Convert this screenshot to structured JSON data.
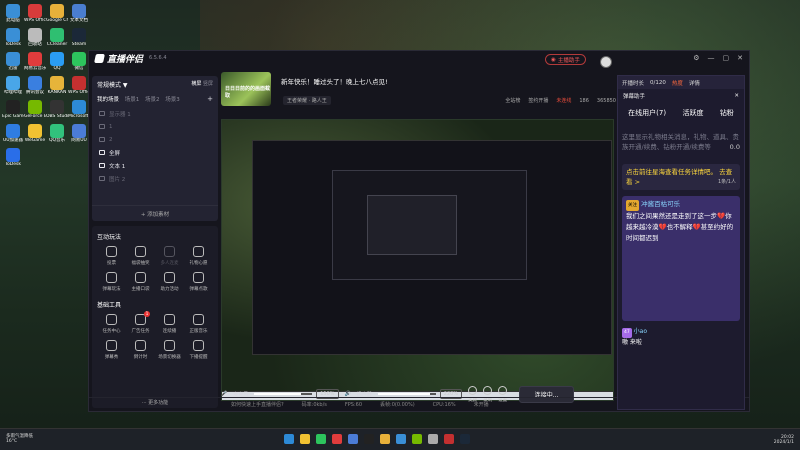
{
  "desktop": {
    "icons": [
      {
        "label": "此电脑",
        "color": "#3a8fd6"
      },
      {
        "label": "WPS Office",
        "color": "#d83b3b"
      },
      {
        "label": "Google Chrome",
        "color": "#e8b13a"
      },
      {
        "label": "文本文档",
        "color": "#4a7ed0"
      },
      {
        "label": "ToDesk",
        "color": "#3a8fd6"
      },
      {
        "label": "回收站",
        "color": "#bbb"
      },
      {
        "label": "CCleaner",
        "color": "#2fbf71"
      },
      {
        "label": "Steam",
        "color": "#1b2838"
      },
      {
        "label": "迅雷",
        "color": "#3a8fd6"
      },
      {
        "label": "网易云音乐",
        "color": "#e03c3c"
      },
      {
        "label": "QQ",
        "color": "#2a9df4"
      },
      {
        "label": "微信",
        "color": "#2dc45d"
      },
      {
        "label": "哔哩哔哩",
        "color": "#49a6e8"
      },
      {
        "label": "腾讯会议",
        "color": "#3a7fe0"
      },
      {
        "label": "KANKAN",
        "color": "#e6b43a"
      },
      {
        "label": "WPS Office",
        "color": "#c43030"
      },
      {
        "label": "Epic Games Launcher",
        "color": "#222"
      },
      {
        "label": "GeForce Experience",
        "color": "#76b900"
      },
      {
        "label": "OBS Studio",
        "color": "#333"
      },
      {
        "label": "Microsoft Edge",
        "color": "#2d8ad6"
      },
      {
        "label": "UU加速器",
        "color": "#2f7de1"
      },
      {
        "label": "WeGame",
        "color": "#f1c232"
      },
      {
        "label": "QQ音乐",
        "color": "#31c27c"
      },
      {
        "label": "网易UU",
        "color": "#4b7cd6"
      },
      {
        "label": "ToDesk",
        "color": "#2a6ee8"
      }
    ]
  },
  "app": {
    "name": "直播伴侣",
    "version": "6.5.6.4",
    "go_live": "主播助手",
    "window_controls": [
      "⚙",
      "—",
      "▢",
      "✕"
    ]
  },
  "scene": {
    "mode": "常规模式 ▼",
    "mode_right": [
      "横屏",
      "竖屏"
    ],
    "my_scenes": "我的场景",
    "scene_tabs": [
      "场景1",
      "场景2",
      "场景3"
    ],
    "sources": [
      {
        "label": "显示器 1",
        "on": false
      },
      {
        "label": "1",
        "on": false
      },
      {
        "label": "2",
        "on": false
      },
      {
        "label": "全屏",
        "on": true
      },
      {
        "label": "文本 1",
        "on": true
      },
      {
        "label": "图片 2",
        "on": false
      }
    ],
    "add_source": "+ 添加素材"
  },
  "tools": {
    "section1": "互动玩法",
    "items1": [
      {
        "label": "投票",
        "dim": false
      },
      {
        "label": "福袋抽奖",
        "dim": false
      },
      {
        "label": "多人连麦",
        "dim": true
      },
      {
        "label": "礼物心愿",
        "dim": false
      },
      {
        "label": "弹幕玩法",
        "dim": false
      },
      {
        "label": "主播口袋",
        "dim": false
      },
      {
        "label": "助力活动",
        "dim": false
      },
      {
        "label": "弹幕点歌",
        "dim": false
      }
    ],
    "section2": "基础工具",
    "items2": [
      {
        "label": "任务中心",
        "badge": ""
      },
      {
        "label": "广告任务",
        "badge": "1"
      },
      {
        "label": "连续播",
        "badge": ""
      },
      {
        "label": "正版音乐",
        "badge": ""
      },
      {
        "label": "弹幕秀",
        "badge": ""
      },
      {
        "label": "倒计时",
        "badge": ""
      },
      {
        "label": "场景切换器",
        "badge": ""
      },
      {
        "label": "下播提醒",
        "badge": ""
      }
    ],
    "more": "··· 更多功能"
  },
  "room": {
    "cover_text": "日日日前的的画面截取",
    "title": "新年快乐！睡过头了！晚上七八点见!",
    "category": "王者荣耀 · 路人王",
    "links": [
      "开播提醒",
      "分享"
    ],
    "meta": [
      "全站榜",
      "签约开播",
      "未连线",
      "186",
      "365850"
    ]
  },
  "controls": {
    "mic_label": "麦克风",
    "mic_pct": "150%",
    "spk_label": "扬声器",
    "spk_pct": "220%",
    "buttons": [
      "美颜",
      "录制",
      "设置"
    ],
    "connect": "连接中..."
  },
  "status": {
    "tip": "如何快速上手直播伴侣?",
    "items": [
      "码率:0kb/s",
      "FPS:60",
      "丢帧:0(0.00%)",
      "CPU:16%",
      "未开播"
    ]
  },
  "assistant": {
    "outer": [
      "开播时长",
      "0/120",
      "热度",
      "详情"
    ],
    "title": "弹幕助手",
    "tabs": [
      "在线用户(7)",
      "活跃度",
      "钻粉"
    ],
    "empty_msg": "这里显示礼物相关消息，礼物、道具、贵族开通/续费、钻粉开通/续费等",
    "stat": "0.0",
    "notice": "点击前往星海查看任务详情吧。 去查看 >",
    "page": "1条/1人",
    "chat_name": "冲酱百枯可乐",
    "chat_text": "我们之间果然还是走到了这一步💔你越来越冷漠💔也不解释💔甚至约好的时间都迟到",
    "level1": "47",
    "tail_name": "小ao",
    "tail_text": "嗷 来啦"
  },
  "taskbar": {
    "left": [
      "多雨气温降低",
      "16°C"
    ],
    "time": "20:02",
    "date": "2024/1/1"
  }
}
